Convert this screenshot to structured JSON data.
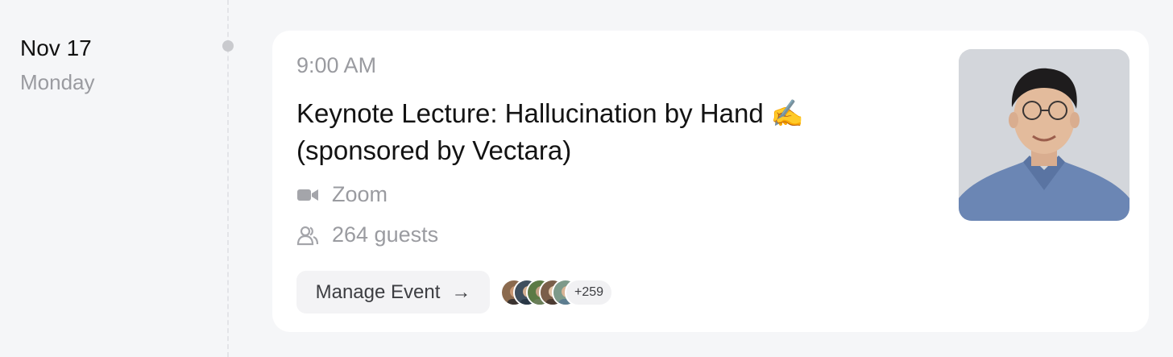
{
  "date": {
    "day": "Nov 17",
    "weekday": "Monday"
  },
  "event": {
    "time": "9:00 AM",
    "title_line1": "Keynote Lecture: Hallucination by Hand",
    "title_emoji": "✍️",
    "title_line2": "(sponsored by Vectara)",
    "location": "Zoom",
    "guests": "264 guests",
    "manage_label": "Manage Event",
    "manage_arrow": "→",
    "extra_guests": "+259"
  },
  "icons": {
    "location": "video-camera-icon",
    "guests": "people-icon",
    "manage": "arrow-right-icon"
  },
  "colors": {
    "background": "#f5f6f8",
    "card": "#ffffff",
    "muted_text": "#9a9ba0",
    "primary_text": "#131313",
    "button_bg": "#f3f3f5"
  }
}
